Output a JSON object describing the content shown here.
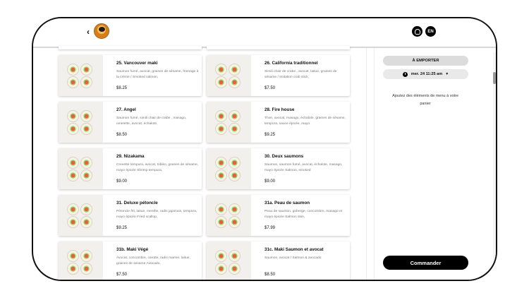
{
  "header": {
    "language": "EN"
  },
  "menu": {
    "items": [
      {
        "title": "25. Vancouver maki",
        "description": "Saumon fumé, avocat, graines de sésame, fromage à la crème / Smoked salmon,",
        "price": "$8.25"
      },
      {
        "title": "26. California traditionnel",
        "description": "Simili chair de crabe , avocat, laitue, graines de sésame / Imitation crab stick,",
        "price": "$7.50"
      },
      {
        "title": "27. Angel",
        "description": "Saumon fumé, simili chair de crabe , masago, omelette, avocat, échalote,",
        "price": "$8.50"
      },
      {
        "title": "28. Fire house",
        "description": "Thon, avocat, masago, échalote, graines de sésame, tempura, sauce épicée, mayo",
        "price": "$9.25"
      },
      {
        "title": "29. Nizakama",
        "description": "Crevette tempura, avocat, tobiko, graines de sésame, mayo épicée Shrimp tempura,",
        "price": "$9.00"
      },
      {
        "title": "30. Deux saumons",
        "description": "Saumon, saumon fumé, avocat, échalote, masago, mayo épicée Salmon, smoked",
        "price": "$9.00"
      },
      {
        "title": "31. Deluxe pétoncle",
        "description": "Pétoncle frit, laitue, menthe, radis japonais, tempura, mayo épicée Fried scallop,",
        "price": "$9.25"
      },
      {
        "title": "31a. Peau de saumon",
        "description": "Peau de saumon, goberge, concombre, masago et mayo épicée Salmon skin,",
        "price": "$7.99"
      },
      {
        "title": "31b. Maki Végé",
        "description": "Avocat, concombre, carotte, radis mariné, laitue, graines de sésame Avocado,",
        "price": "$7.50"
      },
      {
        "title": "31c. Maki Saumon et avocat",
        "description": "Saumon, avocat / Salmon & avocado",
        "price": "$8.50"
      }
    ]
  },
  "cart": {
    "mode": "À EMPORTER",
    "time": "mer. 24 11:25 am",
    "empty_message": "Ajoutez des éléments de menu à votre panier",
    "order_button": "Commander"
  },
  "icons": [
    "back-icon",
    "restaurant-logo",
    "profile-icon",
    "clock-icon",
    "caret-down-icon"
  ],
  "colors": {
    "primary": "#000000",
    "muted_button": "#dcdcdc",
    "card_shadow": "#d8d8d8"
  }
}
